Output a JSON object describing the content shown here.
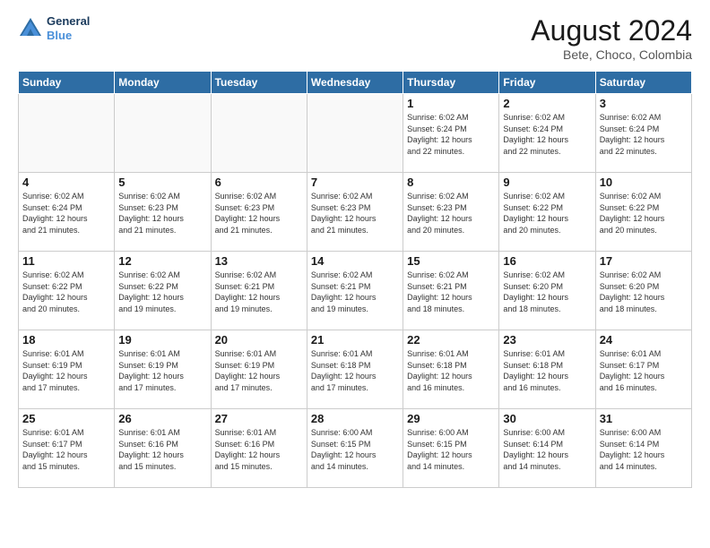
{
  "header": {
    "logo_line1": "General",
    "logo_line2": "Blue",
    "month_title": "August 2024",
    "location": "Bete, Choco, Colombia"
  },
  "weekdays": [
    "Sunday",
    "Monday",
    "Tuesday",
    "Wednesday",
    "Thursday",
    "Friday",
    "Saturday"
  ],
  "weeks": [
    [
      {
        "day": "",
        "info": ""
      },
      {
        "day": "",
        "info": ""
      },
      {
        "day": "",
        "info": ""
      },
      {
        "day": "",
        "info": ""
      },
      {
        "day": "1",
        "info": "Sunrise: 6:02 AM\nSunset: 6:24 PM\nDaylight: 12 hours\nand 22 minutes."
      },
      {
        "day": "2",
        "info": "Sunrise: 6:02 AM\nSunset: 6:24 PM\nDaylight: 12 hours\nand 22 minutes."
      },
      {
        "day": "3",
        "info": "Sunrise: 6:02 AM\nSunset: 6:24 PM\nDaylight: 12 hours\nand 22 minutes."
      }
    ],
    [
      {
        "day": "4",
        "info": "Sunrise: 6:02 AM\nSunset: 6:24 PM\nDaylight: 12 hours\nand 21 minutes."
      },
      {
        "day": "5",
        "info": "Sunrise: 6:02 AM\nSunset: 6:23 PM\nDaylight: 12 hours\nand 21 minutes."
      },
      {
        "day": "6",
        "info": "Sunrise: 6:02 AM\nSunset: 6:23 PM\nDaylight: 12 hours\nand 21 minutes."
      },
      {
        "day": "7",
        "info": "Sunrise: 6:02 AM\nSunset: 6:23 PM\nDaylight: 12 hours\nand 21 minutes."
      },
      {
        "day": "8",
        "info": "Sunrise: 6:02 AM\nSunset: 6:23 PM\nDaylight: 12 hours\nand 20 minutes."
      },
      {
        "day": "9",
        "info": "Sunrise: 6:02 AM\nSunset: 6:22 PM\nDaylight: 12 hours\nand 20 minutes."
      },
      {
        "day": "10",
        "info": "Sunrise: 6:02 AM\nSunset: 6:22 PM\nDaylight: 12 hours\nand 20 minutes."
      }
    ],
    [
      {
        "day": "11",
        "info": "Sunrise: 6:02 AM\nSunset: 6:22 PM\nDaylight: 12 hours\nand 20 minutes."
      },
      {
        "day": "12",
        "info": "Sunrise: 6:02 AM\nSunset: 6:22 PM\nDaylight: 12 hours\nand 19 minutes."
      },
      {
        "day": "13",
        "info": "Sunrise: 6:02 AM\nSunset: 6:21 PM\nDaylight: 12 hours\nand 19 minutes."
      },
      {
        "day": "14",
        "info": "Sunrise: 6:02 AM\nSunset: 6:21 PM\nDaylight: 12 hours\nand 19 minutes."
      },
      {
        "day": "15",
        "info": "Sunrise: 6:02 AM\nSunset: 6:21 PM\nDaylight: 12 hours\nand 18 minutes."
      },
      {
        "day": "16",
        "info": "Sunrise: 6:02 AM\nSunset: 6:20 PM\nDaylight: 12 hours\nand 18 minutes."
      },
      {
        "day": "17",
        "info": "Sunrise: 6:02 AM\nSunset: 6:20 PM\nDaylight: 12 hours\nand 18 minutes."
      }
    ],
    [
      {
        "day": "18",
        "info": "Sunrise: 6:01 AM\nSunset: 6:19 PM\nDaylight: 12 hours\nand 17 minutes."
      },
      {
        "day": "19",
        "info": "Sunrise: 6:01 AM\nSunset: 6:19 PM\nDaylight: 12 hours\nand 17 minutes."
      },
      {
        "day": "20",
        "info": "Sunrise: 6:01 AM\nSunset: 6:19 PM\nDaylight: 12 hours\nand 17 minutes."
      },
      {
        "day": "21",
        "info": "Sunrise: 6:01 AM\nSunset: 6:18 PM\nDaylight: 12 hours\nand 17 minutes."
      },
      {
        "day": "22",
        "info": "Sunrise: 6:01 AM\nSunset: 6:18 PM\nDaylight: 12 hours\nand 16 minutes."
      },
      {
        "day": "23",
        "info": "Sunrise: 6:01 AM\nSunset: 6:18 PM\nDaylight: 12 hours\nand 16 minutes."
      },
      {
        "day": "24",
        "info": "Sunrise: 6:01 AM\nSunset: 6:17 PM\nDaylight: 12 hours\nand 16 minutes."
      }
    ],
    [
      {
        "day": "25",
        "info": "Sunrise: 6:01 AM\nSunset: 6:17 PM\nDaylight: 12 hours\nand 15 minutes."
      },
      {
        "day": "26",
        "info": "Sunrise: 6:01 AM\nSunset: 6:16 PM\nDaylight: 12 hours\nand 15 minutes."
      },
      {
        "day": "27",
        "info": "Sunrise: 6:01 AM\nSunset: 6:16 PM\nDaylight: 12 hours\nand 15 minutes."
      },
      {
        "day": "28",
        "info": "Sunrise: 6:00 AM\nSunset: 6:15 PM\nDaylight: 12 hours\nand 14 minutes."
      },
      {
        "day": "29",
        "info": "Sunrise: 6:00 AM\nSunset: 6:15 PM\nDaylight: 12 hours\nand 14 minutes."
      },
      {
        "day": "30",
        "info": "Sunrise: 6:00 AM\nSunset: 6:14 PM\nDaylight: 12 hours\nand 14 minutes."
      },
      {
        "day": "31",
        "info": "Sunrise: 6:00 AM\nSunset: 6:14 PM\nDaylight: 12 hours\nand 14 minutes."
      }
    ]
  ]
}
